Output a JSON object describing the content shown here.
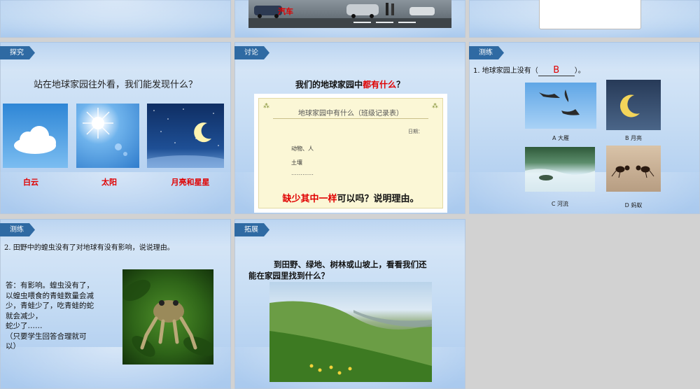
{
  "top_middle": {
    "photo_label": "汽车"
  },
  "explore": {
    "tag": "探究",
    "question": "站在地球家园往外看，我们能发现什么？",
    "labels": [
      "白云",
      "太阳",
      "月亮和星星"
    ]
  },
  "discuss": {
    "tag": "讨论",
    "question_prefix": "我们的地球家园中",
    "question_highlight": "都有什么",
    "question_suffix": "？",
    "card_title": "地球家园中有什么（班级记录表）",
    "card_date": "日期：",
    "card_lines": [
      "动物、人",
      "土壤",
      "…………"
    ],
    "bottom_highlight": "缺少其中一样",
    "bottom_rest": "可以吗？说明理由。"
  },
  "test1": {
    "tag": "测练",
    "question_prefix": "1. 地球家园上没有（",
    "answer": "B",
    "question_suffix": "）。",
    "options": [
      "A 大雁",
      "B 月亮",
      "C 河流",
      "D 蚂蚁"
    ]
  },
  "test2": {
    "tag": "测练",
    "question": "2. 田野中的蝗虫没有了对地球有没有影响，说说理由。",
    "answer_lines": [
      "答：有影响。蝗虫没有了，",
      "以蝗虫喂食的青蛙数量会减",
      "少，青蛙少了，吃青蛙的蛇",
      "就会减少，",
      "蛇少了……",
      "（只要学生回答合理就可",
      "以）"
    ]
  },
  "expand": {
    "tag": "拓展",
    "line1": "到田野、绿地、树林或山坡上，看看我们还",
    "line2": "能在家园里找到什么？"
  }
}
